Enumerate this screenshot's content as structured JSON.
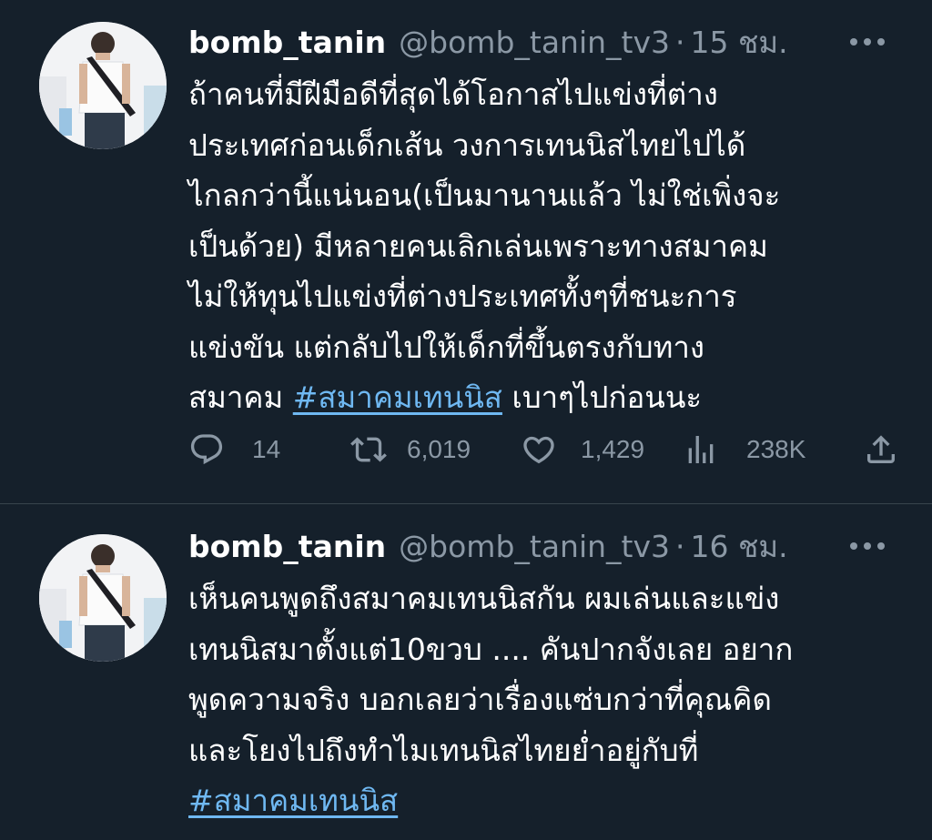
{
  "tweets": [
    {
      "author_name": "bomb_tanin",
      "author_handle": "@bomb_tanin_tv3",
      "separator": "·",
      "timestamp": "15 ชม.",
      "text_lines": [
        "ถ้าคนที่มีฝีมือดีที่สุดได้โอกาสไปแข่งที่ต่าง",
        "ประเทศก่อนเด็กเส้น วงการเทนนิสไทยไปได้",
        "ไกลกว่านี้แน่นอน(เป็นมานานแล้ว ไม่ใช่เพิ่งจะ",
        "เป็นด้วย) มีหลายคนเลิกเล่นเพราะทางสมาคม",
        "ไม่ให้ทุนไปแข่งที่ต่างประเทศทั้งๆที่ชนะการ",
        "แข่งขัน แต่กลับไปให้เด็กที่ขึ้นตรงกับทาง"
      ],
      "last_line_prefix": "สมาคม ",
      "hashtag": "#สมาคมเทนนิส",
      "last_line_suffix": " เบาๆไปก่อนนะ",
      "replies": "14",
      "retweets": "6,019",
      "likes": "1,429",
      "views": "238K",
      "icons": [
        "reply-icon",
        "retweet-icon",
        "like-icon",
        "views-icon",
        "share-icon"
      ]
    },
    {
      "author_name": "bomb_tanin",
      "author_handle": "@bomb_tanin_tv3",
      "separator": "·",
      "timestamp": "16 ชม.",
      "text_lines": [
        "เห็นคนพูดถึงสมาคมเทนนิสกัน ผมเล่นและแข่ง",
        "เทนนิสมาตั้งแต่10ขวบ .... คันปากจังเลย อยาก",
        "พูดความจริง บอกเลยว่าเรื่องแซ่บกว่าที่คุณคิด",
        "และโยงไปถึงทำไมเทนนิสไทยย่ำอยู่กับที่"
      ],
      "hashtag": "#สมาคมเทนนิส"
    }
  ],
  "colors": {
    "background": "#15202b",
    "text": "#ffffff",
    "secondary": "#8b98a5",
    "link": "#6fb8f2",
    "divider": "#38444d"
  }
}
